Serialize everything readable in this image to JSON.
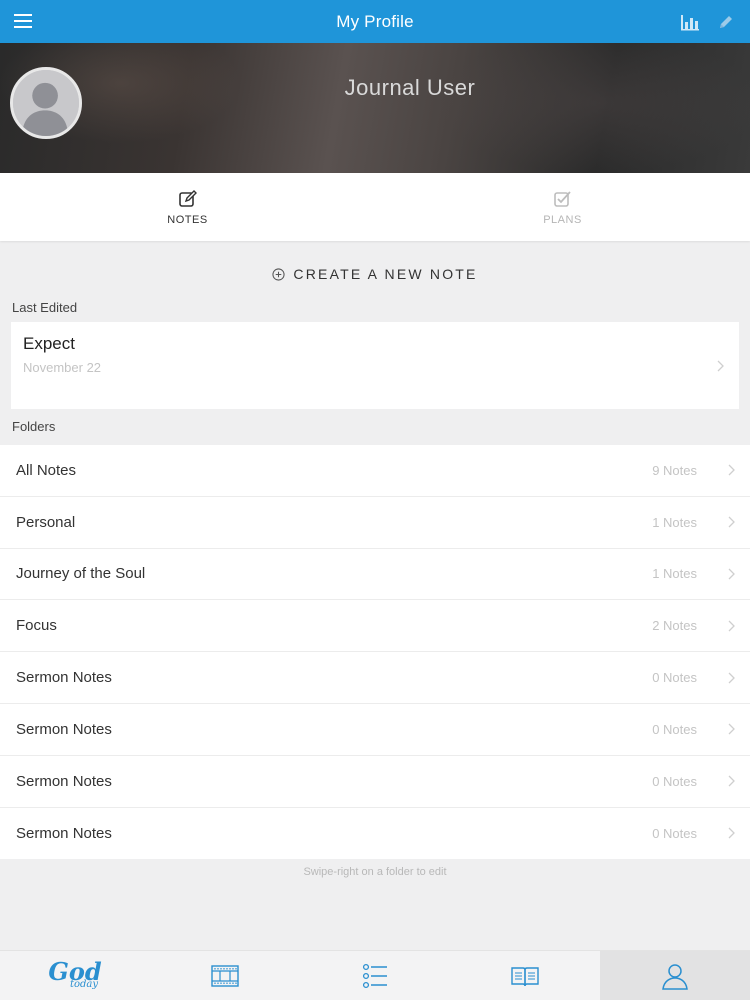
{
  "header": {
    "title": "My Profile",
    "menu_icon": "hamburger-menu-icon",
    "stats_icon": "bar-chart-icon",
    "edit_icon": "pencil-icon",
    "accent": "#1f95d9"
  },
  "profile": {
    "name": "Journal User"
  },
  "tabs": [
    {
      "label": "NOTES",
      "icon": "edit-note-icon",
      "active": true
    },
    {
      "label": "PLANS",
      "icon": "checkbox-icon",
      "active": false
    }
  ],
  "create": {
    "label": "CREATE A NEW NOTE",
    "icon": "plus-circle-icon"
  },
  "last_edited": {
    "label": "Last Edited",
    "title": "Expect",
    "date": "November 22"
  },
  "folders": {
    "label": "Folders",
    "items": [
      {
        "name": "All Notes",
        "count": "9 Notes"
      },
      {
        "name": "Personal",
        "count": "1 Notes"
      },
      {
        "name": "Journey of the Soul",
        "count": "1 Notes"
      },
      {
        "name": "Focus",
        "count": "2 Notes"
      },
      {
        "name": "Sermon Notes",
        "count": "0 Notes"
      },
      {
        "name": "Sermon Notes",
        "count": "0 Notes"
      },
      {
        "name": "Sermon Notes",
        "count": "0 Notes"
      },
      {
        "name": "Sermon Notes",
        "count": "0 Notes"
      }
    ]
  },
  "hint": "Swipe-right on a folder to edit",
  "bottom_nav": {
    "logo": {
      "line1": "God",
      "line2": "today"
    },
    "items": [
      "film-icon",
      "list-icon",
      "book-icon",
      "profile-icon"
    ],
    "active": "profile-icon"
  }
}
